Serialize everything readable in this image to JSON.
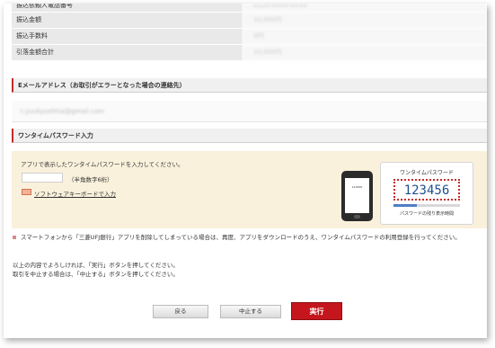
{
  "summary": {
    "rows": [
      {
        "label": "振込依頼人電話番号",
        "value": "0120-XXXX-XXXX"
      },
      {
        "label": "振込金額",
        "value": "10,000円"
      },
      {
        "label": "振込手数料",
        "value": "0円"
      },
      {
        "label": "引落金額合計",
        "value": "10,000円"
      }
    ]
  },
  "email_section": {
    "title": "Eメールアドレス（お取引がエラーとなった場合の連絡先）",
    "value": "t.yuukyoshitai@gmail.com"
  },
  "otp_section": {
    "title": "ワンタイムパスワード入力",
    "instruction": "アプリで表示したワンタイムパスワードを入力してください。",
    "input_value": "",
    "input_hint": "（半角数字6桁）",
    "keyboard_link": "ソフトウェアキーボードで入力",
    "illustration": {
      "card_title": "ワンタイムパスワード",
      "code": "123456",
      "remaining_fraction": 0.35,
      "footer": "パスワードの残り表示時間"
    }
  },
  "note": "スマートフォンから「三菱UFJ銀行」アプリを削除してしまっている場合は、再度、アプリをダウンロードのうえ、ワンタイムパスワードの利用登録を行ってください。",
  "confirm": {
    "line1": "以上の内容でよろしければ、「実行」ボタンを押してください。",
    "line2": "取引を中止する場合は、「中止する」ボタンを押してください。"
  },
  "buttons": {
    "back": "戻る",
    "cancel": "中止する",
    "execute": "実行"
  },
  "colors": {
    "accent": "#c42b2b",
    "otp_bg": "#faf1dc",
    "execute_bg": "#c4161c"
  }
}
